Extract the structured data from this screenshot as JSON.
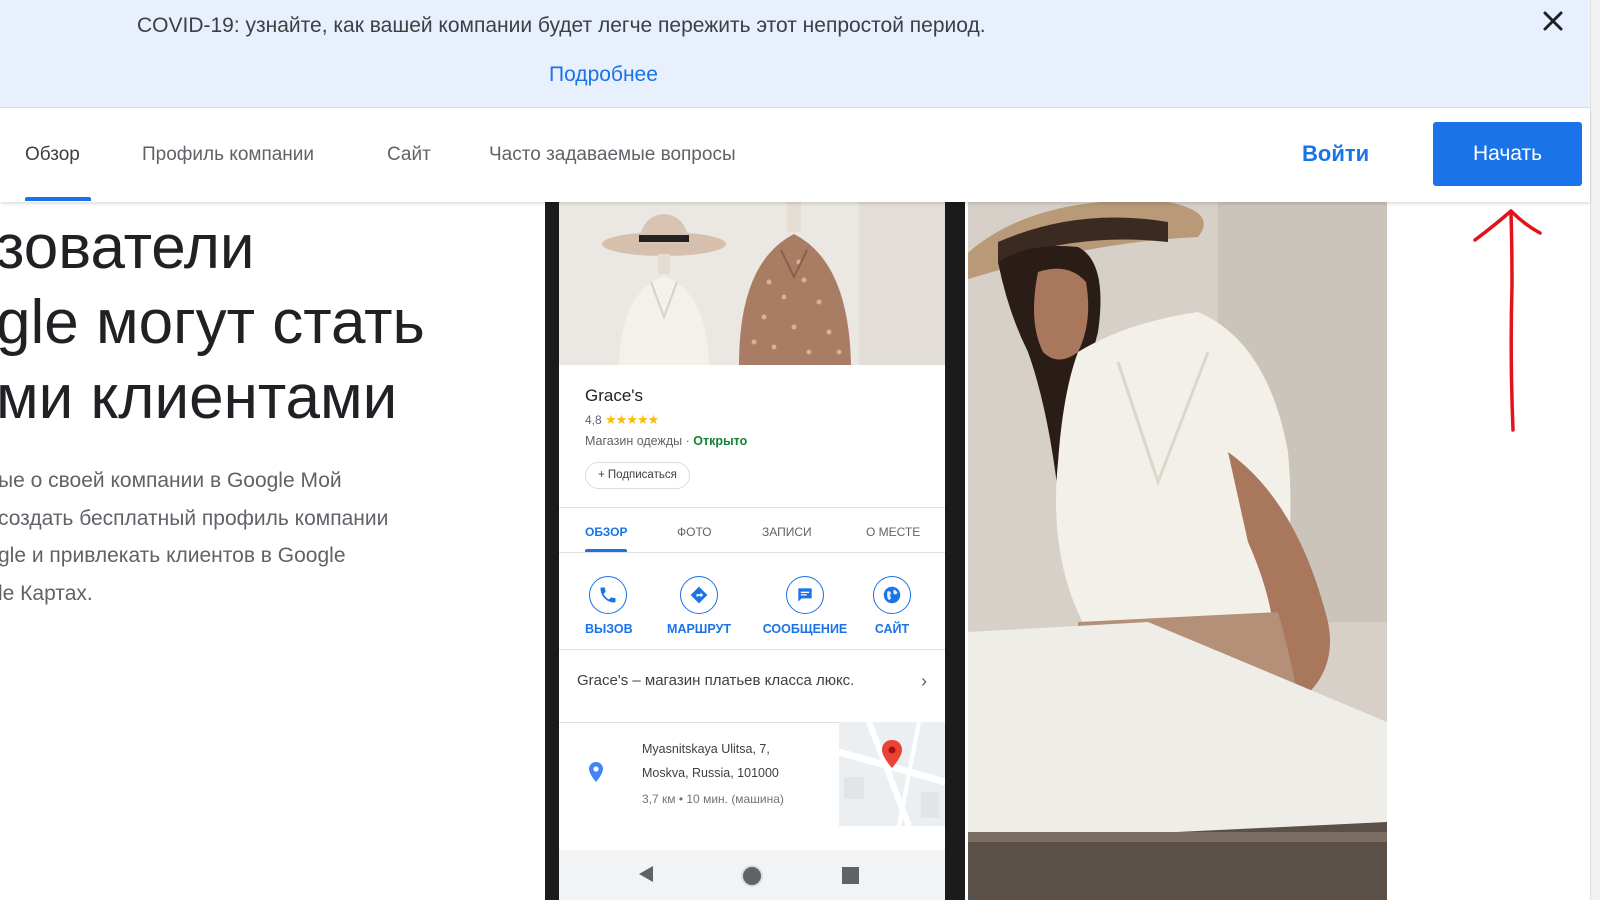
{
  "banner": {
    "text": "COVID-19: узнайте, как вашей компании будет легче пережить этот непростой период.",
    "link": "Подробнее",
    "close_icon": "close-icon"
  },
  "nav": {
    "tabs": [
      {
        "label": "Обзор",
        "active": true
      },
      {
        "label": "Профиль компании",
        "active": false
      },
      {
        "label": "Сайт",
        "active": false
      },
      {
        "label": "Часто задаваемые вопросы",
        "active": false
      }
    ],
    "signin": "Войти",
    "start": "Начать"
  },
  "hero": {
    "headline": [
      "зователи",
      "gle могут стать",
      "ми клиентами"
    ],
    "subtext": [
      "ые о своей компании в Google Мой",
      "создать бесплатный профиль компании",
      "gle и привлекать клиентов в Google",
      "le Картах."
    ]
  },
  "phone": {
    "business_name": "Grace's",
    "rating": "4,8",
    "stars": "★★★★★",
    "category": "Магазин одежды · ",
    "open_status": "Открыто",
    "follow": "+ Подписаться",
    "tabs": [
      {
        "label": "ОБЗОР",
        "active": true
      },
      {
        "label": "ФОТО",
        "active": false
      },
      {
        "label": "ЗАПИСИ",
        "active": false
      },
      {
        "label": "О МЕСТЕ",
        "active": false
      }
    ],
    "actions": [
      {
        "label": "ВЫЗОВ",
        "icon": "phone-icon"
      },
      {
        "label": "МАРШРУТ",
        "icon": "directions-icon"
      },
      {
        "label": "СООБЩЕНИЕ",
        "icon": "message-icon"
      },
      {
        "label": "САЙТ",
        "icon": "globe-icon"
      }
    ],
    "description": "Grace's – магазин платьев класса люкс.",
    "address_line1": "Myasnitskaya Ulitsa, 7,",
    "address_line2": "Moskva, Russia, 101000",
    "distance": "3,7 км • 10 мин. (машина)"
  },
  "colors": {
    "accent": "#1a73e8",
    "banner_bg": "#e8f0fe",
    "open_green": "#188038",
    "star_yellow": "#fbbc04",
    "annotation_red": "#e3131b"
  }
}
